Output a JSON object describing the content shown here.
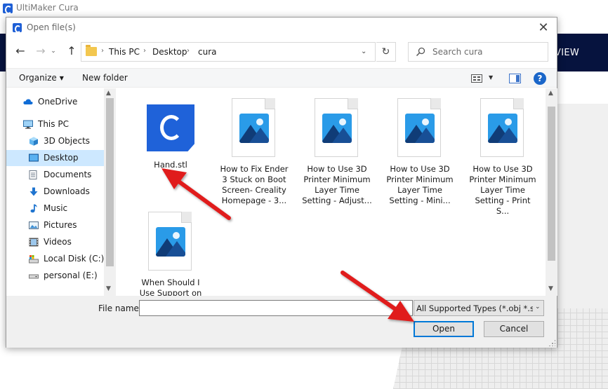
{
  "app": {
    "title": "UltiMaker Cura",
    "view_label": "VIEW"
  },
  "dialog": {
    "title": "Open file(s)",
    "close_symbol": "✕",
    "nav": {
      "back_symbol": "←",
      "forward_symbol": "→",
      "recent_symbol": "⌄",
      "up_symbol": "↑"
    },
    "address": {
      "crumbs": [
        "This PC",
        "Desktop",
        "cura"
      ],
      "separator": "›",
      "dropdown_symbol": "⌄",
      "refresh_symbol": "↻"
    },
    "search": {
      "placeholder": "Search cura"
    },
    "toolbar": {
      "organize_label": "Organize",
      "caret": "▼",
      "new_folder_label": "New folder",
      "help_symbol": "?"
    },
    "sidebar": {
      "items": [
        {
          "label": "OneDrive",
          "icon": "cloud-icon"
        },
        {
          "label": "This PC",
          "icon": "computer-icon"
        },
        {
          "label": "3D Objects",
          "icon": "cube-icon"
        },
        {
          "label": "Desktop",
          "icon": "desktop-icon"
        },
        {
          "label": "Documents",
          "icon": "documents-icon"
        },
        {
          "label": "Downloads",
          "icon": "download-icon"
        },
        {
          "label": "Music",
          "icon": "music-icon"
        },
        {
          "label": "Pictures",
          "icon": "pictures-icon"
        },
        {
          "label": "Videos",
          "icon": "videos-icon"
        },
        {
          "label": "Local Disk (C:)",
          "icon": "disk-icon"
        },
        {
          "label": "personal (E:)",
          "icon": "drive-icon"
        }
      ],
      "selected": "Desktop",
      "scroll_up": "▲",
      "scroll_down": "▼"
    },
    "files": [
      {
        "name": "Hand.stl",
        "type": "stl",
        "icon": "cura-stl-icon"
      },
      {
        "name": "How to Fix Ender 3 Stuck on Boot Screen- Creality Homepage - 3...",
        "type": "image",
        "icon": "image-file-icon"
      },
      {
        "name": "How to Use 3D Printer Minimum Layer Time Setting - Adjust...",
        "type": "image",
        "icon": "image-file-icon"
      },
      {
        "name": "How to Use 3D Printer Minimum Layer Time Setting - Mini...",
        "type": "image",
        "icon": "image-file-icon"
      },
      {
        "name": "How to Use 3D Printer Minimum Layer Time Setting - Print S...",
        "type": "image",
        "icon": "image-file-icon"
      },
      {
        "name": "When Should I Use Support on",
        "type": "image",
        "icon": "image-file-icon"
      }
    ],
    "file_scroll": {
      "up": "▲",
      "down": "▼"
    },
    "bottom": {
      "file_name_label": "File name:",
      "file_name_value": "",
      "file_type_value": "All Supported Types (*.obj *.stl *",
      "file_type_caret": "⌄",
      "open_label": "Open",
      "cancel_label": "Cancel"
    }
  },
  "colors": {
    "cura_blue": "#1f62d9",
    "header_navy": "#06133e",
    "selection": "#cde8ff",
    "arrow_red": "#e01e1e",
    "accent_border": "#0078d7"
  }
}
